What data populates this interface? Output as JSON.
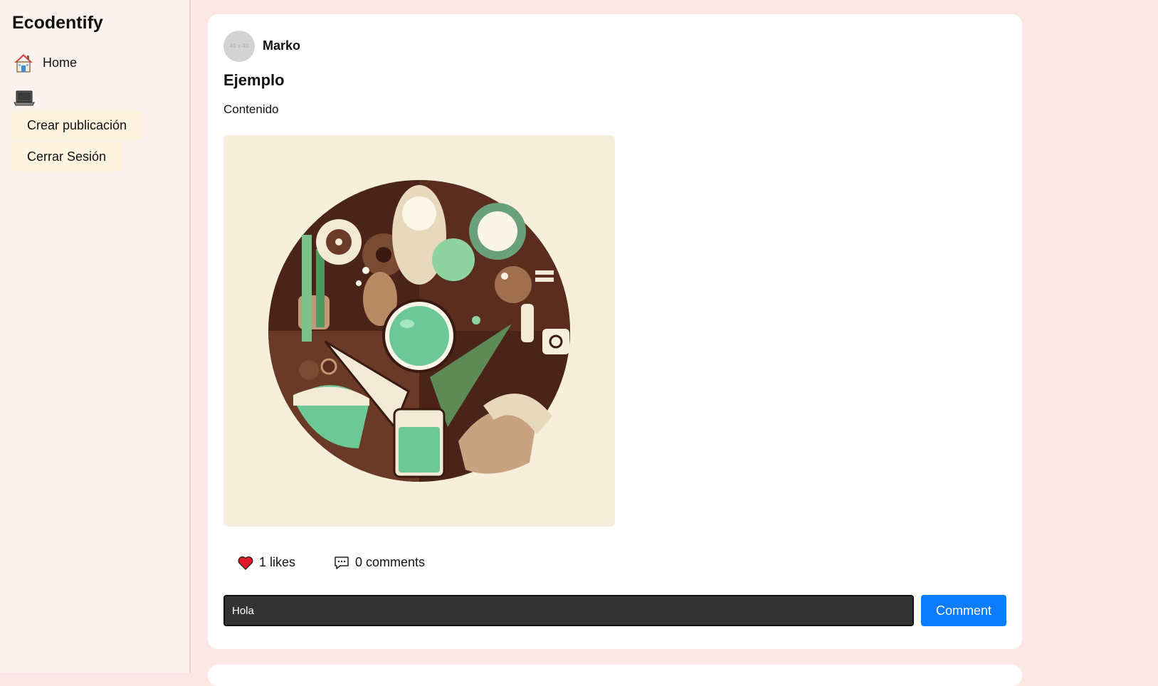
{
  "app": {
    "title": "Ecodentify"
  },
  "sidebar": {
    "home_label": "Home",
    "laptop_icon": "laptop-icon",
    "buttons": [
      {
        "label": "Crear publicación"
      },
      {
        "label": "Cerrar Sesión"
      }
    ]
  },
  "post": {
    "avatar_placeholder": "40 x 40",
    "author": "Marko",
    "title": "Ejemplo",
    "content": "Contenido",
    "likes_label": "1 likes",
    "comments_label": "0 comments",
    "comment_input_value": "Hola",
    "comment_button": "Comment"
  },
  "colors": {
    "page_background": "#fce9e6",
    "sidebar_background": "#fdf2ee",
    "side_button_background": "#fdf3df",
    "comment_button": "#0a7cff",
    "comment_input_background": "#333333",
    "like_heart": "#e0182a"
  },
  "icons": {
    "home": "house-icon",
    "like": "heart-icon",
    "comment": "chat-bubble-icon"
  }
}
